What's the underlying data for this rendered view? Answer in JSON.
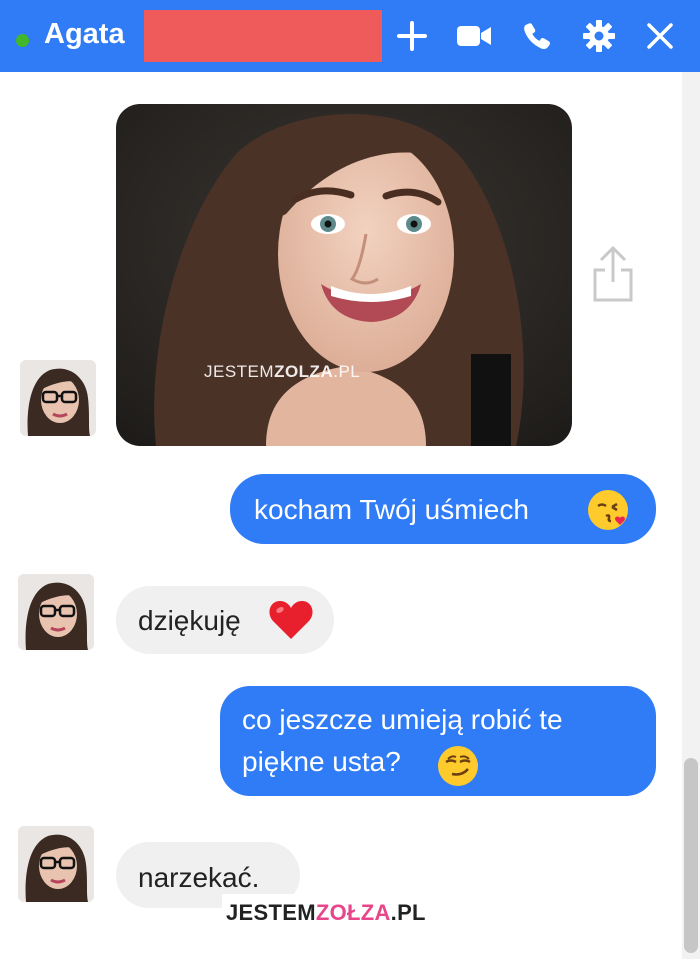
{
  "header": {
    "contact_name": "Agata",
    "status": "online",
    "accent_color": "#2f7cf6",
    "online_color": "#42b72a",
    "icons": [
      "add-icon",
      "video-call-icon",
      "phone-icon",
      "settings-icon",
      "close-icon"
    ]
  },
  "conversation": {
    "photo_watermark": {
      "prefix": "JESTEM",
      "brand": "ZOLZA",
      "suffix": ".PL"
    },
    "messages": [
      {
        "from": "me",
        "text": "kocham Twój uśmiech",
        "emoji": "kissing-face-emoji"
      },
      {
        "from": "contact",
        "text": "dziękuję",
        "emoji": "red-heart-emoji"
      },
      {
        "from": "me",
        "line1": "co jeszcze umieją robić te",
        "line2": "piękne usta?",
        "emoji": "smirking-face-emoji"
      },
      {
        "from": "contact",
        "text": "narzekać."
      }
    ]
  },
  "footer_watermark": {
    "prefix": "JESTEM",
    "brand": "ZOŁZA",
    "suffix": ".PL",
    "brand_color": "#e8468b"
  }
}
